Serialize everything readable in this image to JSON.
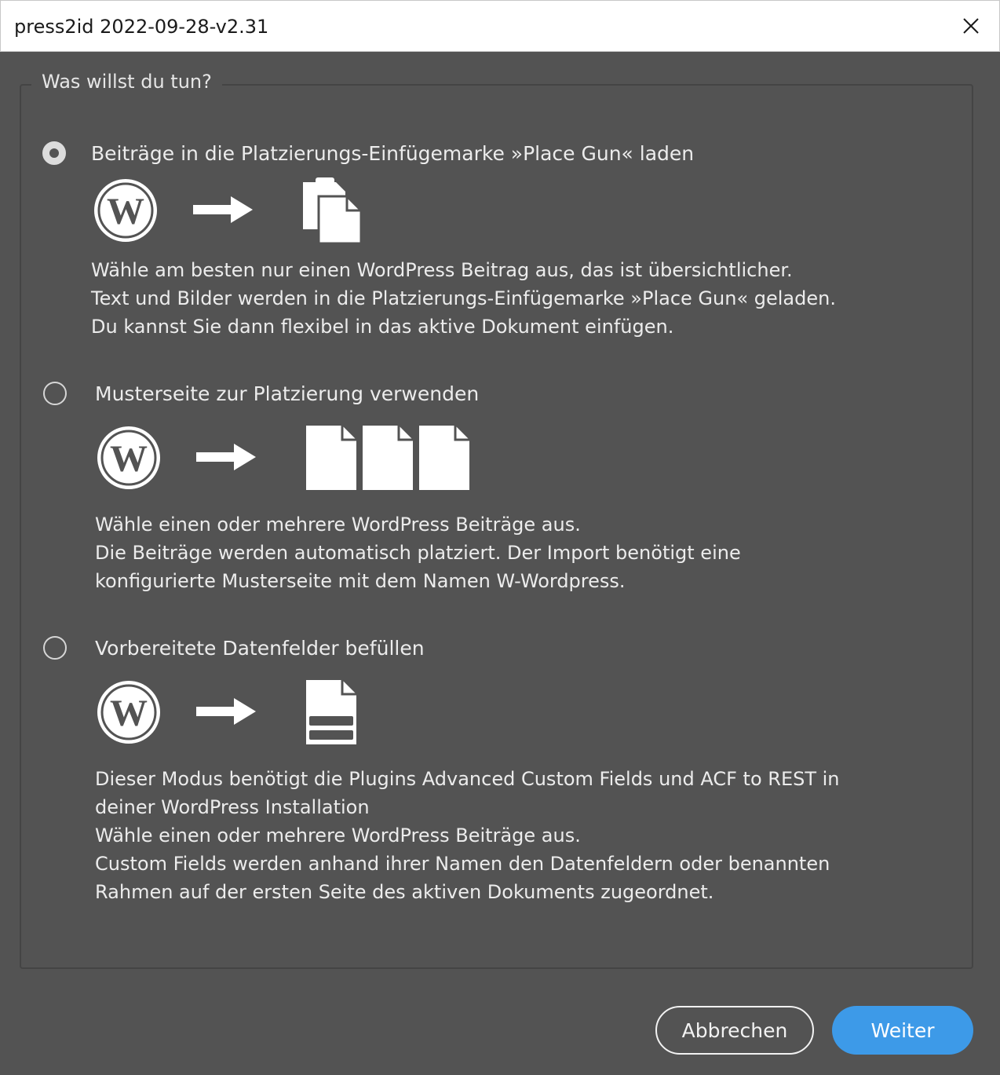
{
  "window": {
    "title": "press2id 2022-09-28-v2.31",
    "close_icon": "close-icon"
  },
  "group": {
    "legend": "Was willst du tun?"
  },
  "options": [
    {
      "label": "Beiträge in die Platzierungs-Einfügemarke »Place Gun« laden",
      "selected": true,
      "desc": [
        "Wähle am besten nur einen WordPress Beitrag aus, das ist übersichtlicher.",
        "Text und Bilder werden in die Platzierungs-Einfügemarke »Place Gun« geladen.",
        "Du kannst Sie dann flexibel in das aktive Dokument einfügen."
      ]
    },
    {
      "label": "Musterseite zur Platzierung verwenden",
      "selected": false,
      "desc": [
        "Wähle einen oder mehrere WordPress Beiträge aus.",
        "Die Beiträge werden automatisch platziert. Der Import benötigt eine",
        "konfigurierte Musterseite mit dem Namen W-Wordpress."
      ]
    },
    {
      "label": "Vorbereitete Datenfelder befüllen",
      "selected": false,
      "desc": [
        "Dieser Modus benötigt die  Plugins Advanced Custom Fields und ACF to REST in",
        "deiner WordPress Installation",
        "Wähle einen oder mehrere WordPress Beiträge aus.",
        "Custom Fields werden anhand ihrer Namen den Datenfeldern oder benannten",
        "Rahmen auf der ersten Seite des aktiven Dokuments zugeordnet."
      ]
    }
  ],
  "buttons": {
    "cancel": "Abbrechen",
    "next": "Weiter"
  },
  "colors": {
    "background": "#535353",
    "accent": "#3d9ae8",
    "text": "#ececec"
  }
}
